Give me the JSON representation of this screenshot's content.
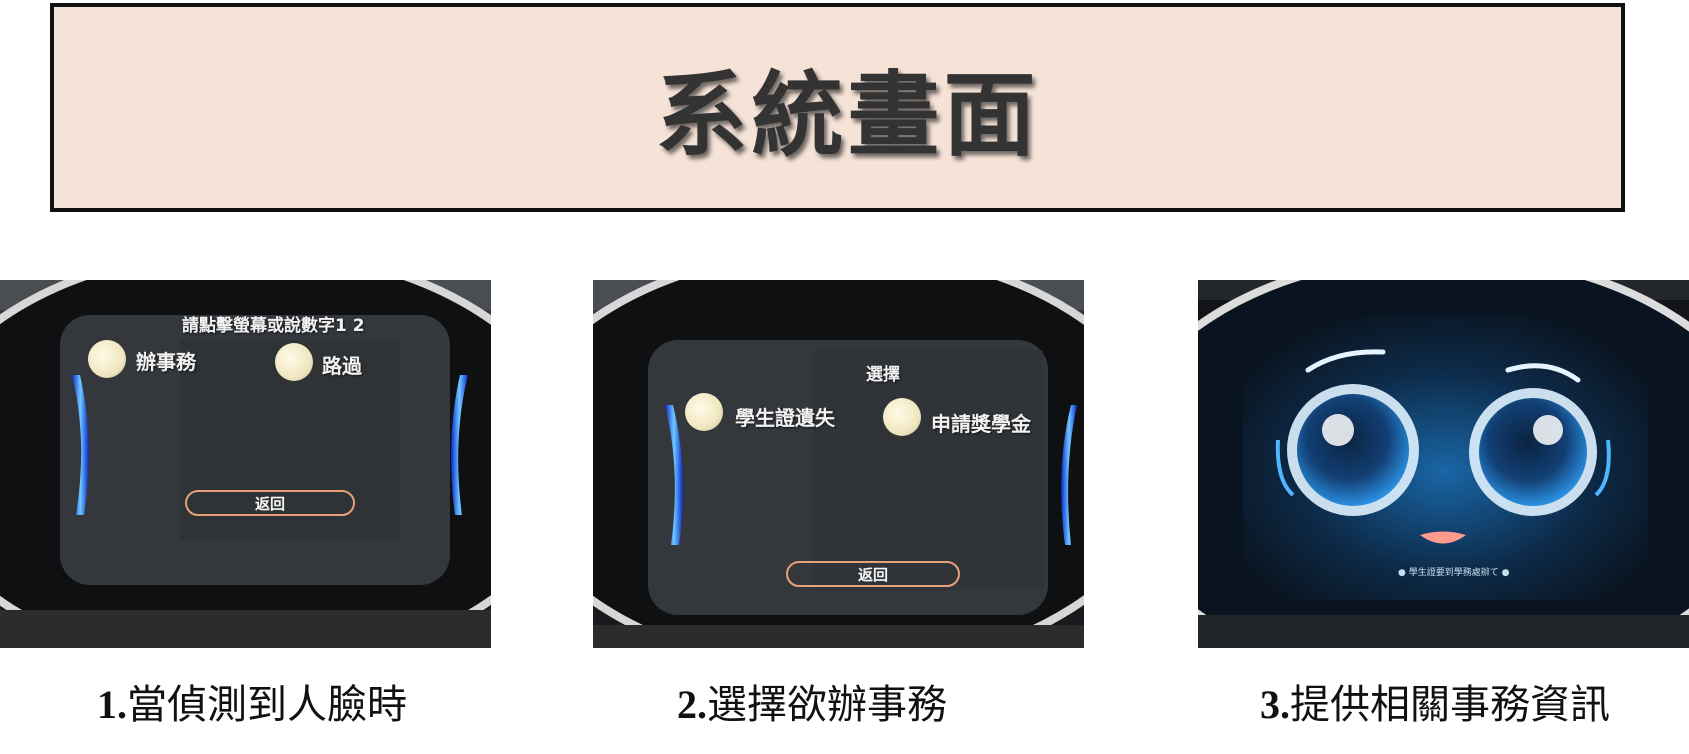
{
  "title": "系統畫面",
  "panels": [
    {
      "prompt": "請點擊螢幕或說數字1 2",
      "options": [
        "辦事務",
        "路過"
      ],
      "back_label": "返回",
      "caption_num": "1.",
      "caption_text": "當偵測到人臉時"
    },
    {
      "prompt": "選擇",
      "options": [
        "學生證遺失",
        "申請獎學金"
      ],
      "back_label": "返回",
      "caption_num": "2.",
      "caption_text": "選擇欲辦事務"
    },
    {
      "status": "● 學生證要到學務處辦て ●",
      "caption_num": "3.",
      "caption_text": "提供相關事務資訊"
    }
  ],
  "colors": {
    "title_bg": "#f6e3d7",
    "title_text": "#333333",
    "button_border": "#e8a07a",
    "eye_blue": "#2a8fe0"
  }
}
